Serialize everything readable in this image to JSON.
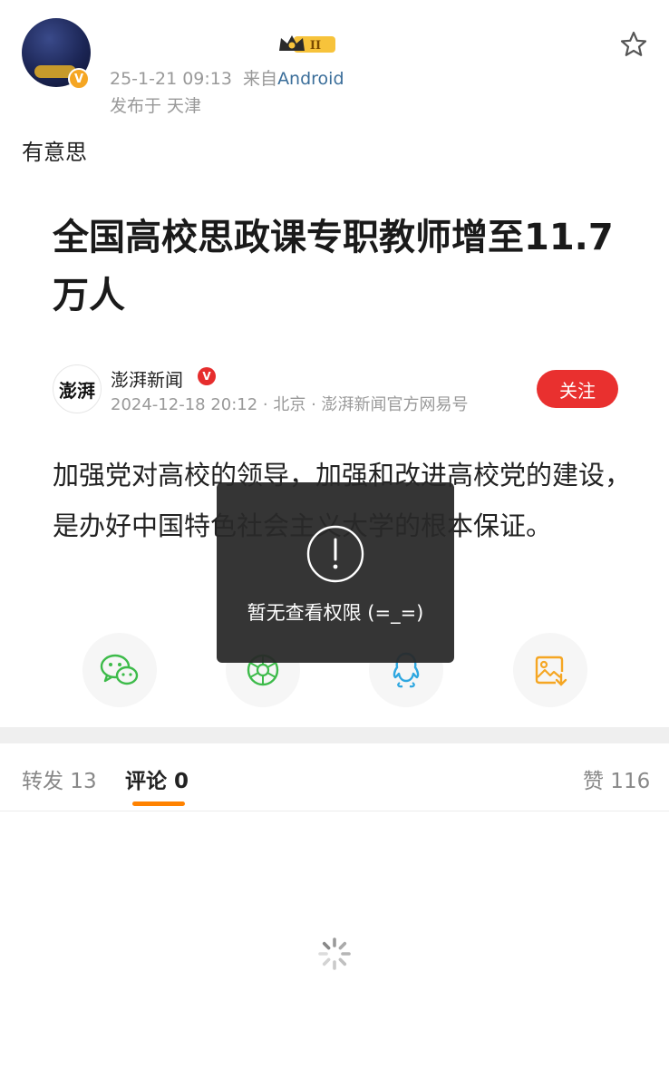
{
  "post": {
    "meta_date": "25-1-21 09:13",
    "meta_from": "来自",
    "meta_source": "Android",
    "location": "发布于 天津",
    "text": "有意思",
    "vip_level": "II"
  },
  "article": {
    "title": "全国高校思政课专职教师增至11.7万人",
    "publisher_logo_text": "澎湃",
    "publisher_name": "澎湃新闻",
    "publisher_meta": "2024-12-18 20:12 · 北京 · 澎湃新闻官方网易号",
    "follow_label": "关注",
    "body_visible": "加强党对高校的领导，加强和改进高校党的建设，是办好中国特色社会主义大学的根本保证。"
  },
  "share": {
    "items": [
      "wechat-icon",
      "moments-icon",
      "qq-icon",
      "save-image-icon"
    ]
  },
  "tabs": {
    "repost": "转发 13",
    "comment": "评论 0",
    "like": "赞 116"
  },
  "toast": {
    "message": "暂无查看权限 (=_=)"
  },
  "colors": {
    "follow": "#e9302f",
    "tab_underline": "#ff8200",
    "source_link": "#3b6e9a",
    "toast_bg": "#282828"
  }
}
